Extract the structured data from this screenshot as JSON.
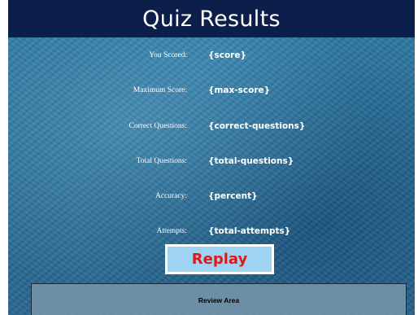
{
  "header": {
    "title": "Quiz Results"
  },
  "results": [
    {
      "label": "You Scored:",
      "value": "{score}"
    },
    {
      "label": "Maximum Score:",
      "value": "{max-score}"
    },
    {
      "label": "Correct Questions:",
      "value": "{correct-questions}"
    },
    {
      "label": "Total Questions:",
      "value": "{total-questions}"
    },
    {
      "label": "Accuracy:",
      "value": "{percent}"
    },
    {
      "label": "Attempts:",
      "value": "{total-attempts}"
    }
  ],
  "actions": {
    "replay_label": "Replay"
  },
  "review": {
    "label": "Review Area"
  },
  "colors": {
    "title_bar": "#0c1f4a",
    "background": "#2a6f99",
    "replay_text": "#e01818",
    "replay_fill": "#9fd3f2"
  }
}
